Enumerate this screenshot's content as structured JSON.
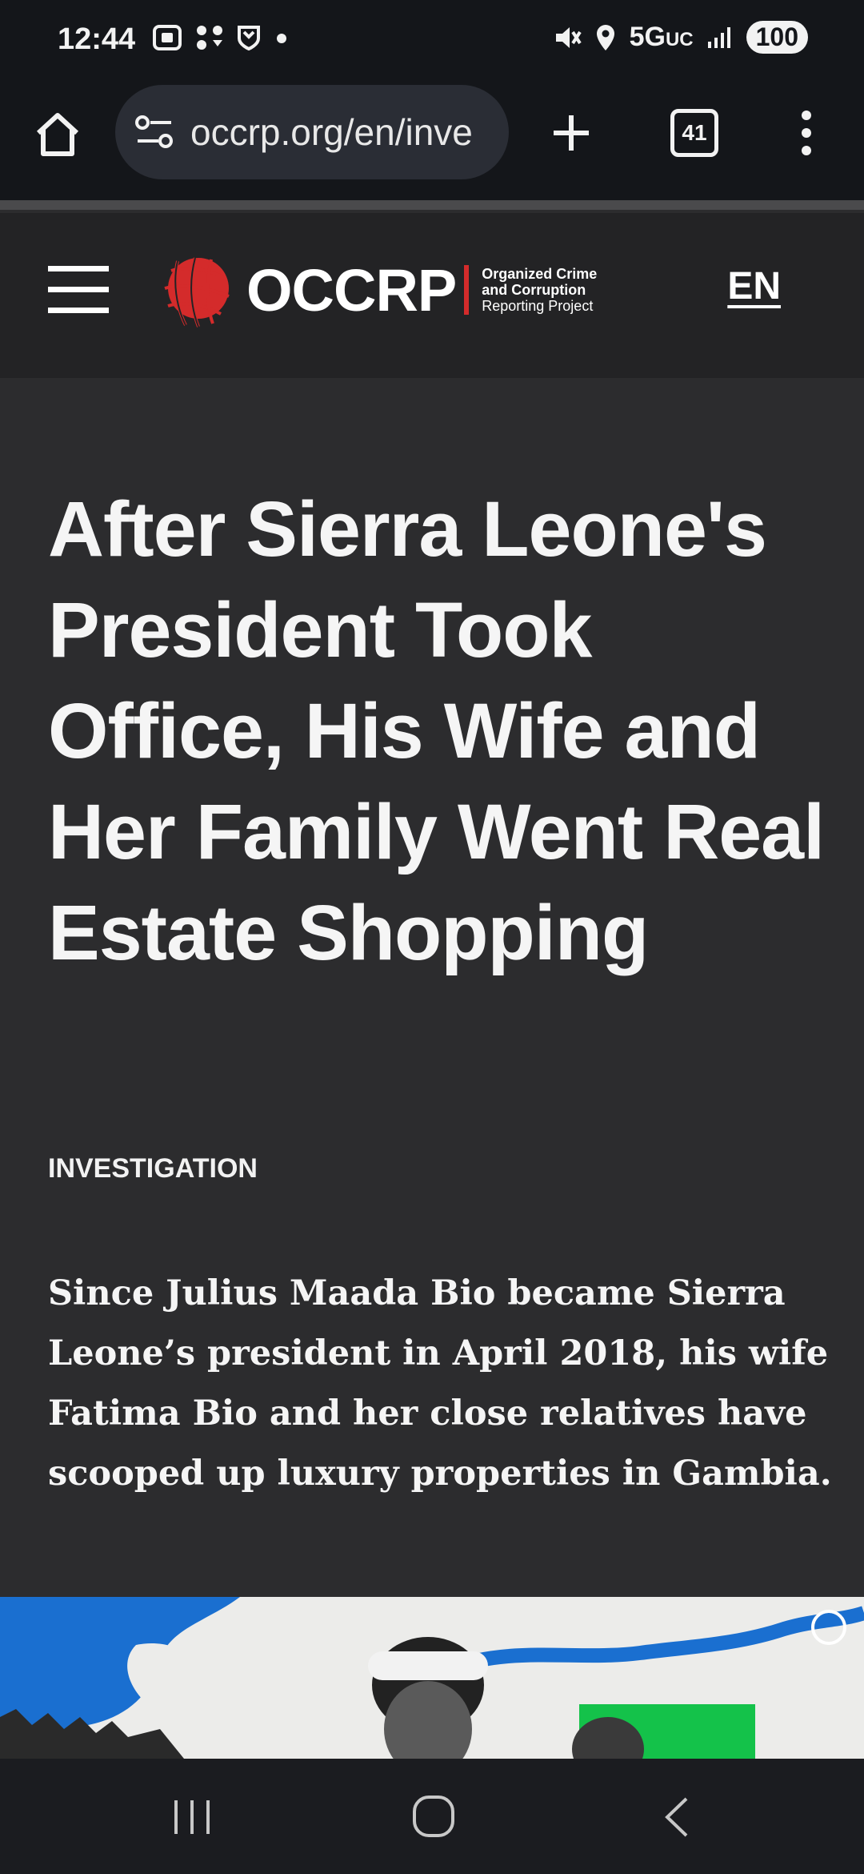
{
  "status_bar": {
    "time": "12:44",
    "network": "5G",
    "network_suffix": "UC",
    "battery": "100"
  },
  "browser": {
    "url": "occrp.org/en/inve",
    "tab_count": "41"
  },
  "site": {
    "logo_word": "OCCRP",
    "logo_sub_1": "Organized Crime",
    "logo_sub_2": "and Corruption",
    "logo_sub_3": "Reporting Project",
    "language": "EN"
  },
  "article": {
    "headline": "After Sierra Leone's President Took Office, His Wife and Her Family Went Real Estate Shopping",
    "category": "INVESTIGATION",
    "lede": "Since Julius Maada Bio became Sierra Leone’s president in April 2018, his wife Fatima Bio and her close relatives have scooped up luxury properties in Gambia."
  }
}
